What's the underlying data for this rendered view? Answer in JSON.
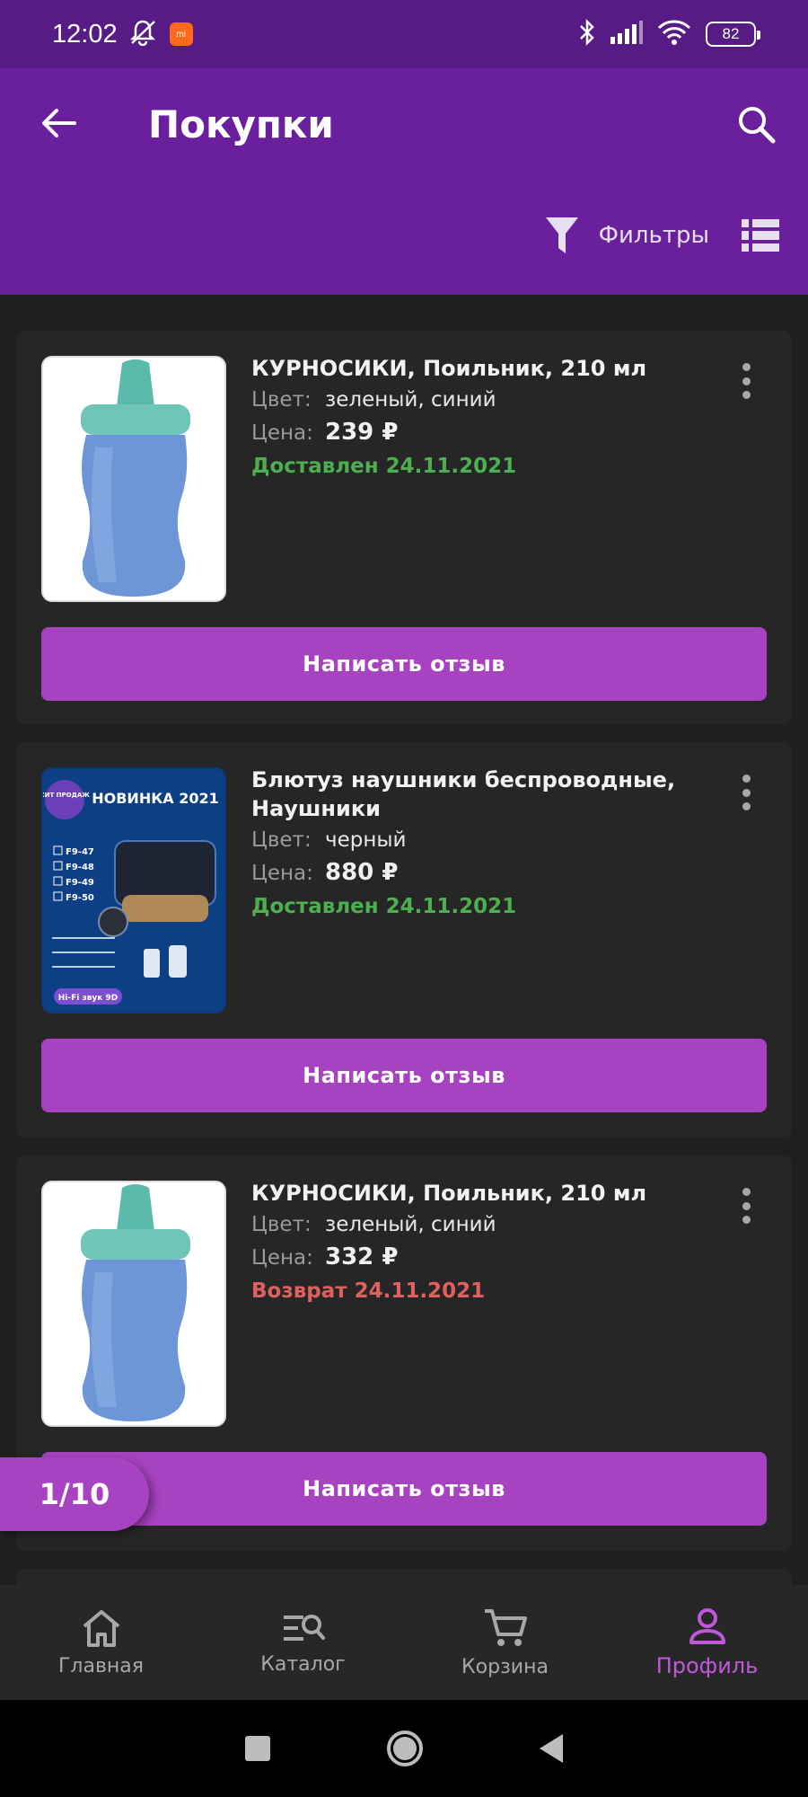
{
  "status_bar": {
    "time": "12:02",
    "battery": "82"
  },
  "header": {
    "title": "Покупки",
    "filters_label": "Фильтры"
  },
  "colors": {
    "accent": "#a742c0",
    "appbar": "#6a1f9c",
    "delivered": "#4caf50",
    "returned": "#e06060"
  },
  "orders": [
    {
      "name": "КУРНОСИКИ, Поильник, 210 мл",
      "color_key": "Цвет:",
      "color": "зеленый, синий",
      "price_key": "Цена:",
      "price": "239 ₽",
      "status": "Доставлен 24.11.2021",
      "review": "Написать отзыв",
      "image": "sippy-cup"
    },
    {
      "name": "Блютуз наушники беспроводные, Наушники",
      "color_key": "Цвет:",
      "color": "черный",
      "price_key": "Цена:",
      "price": "880 ₽",
      "status": "Доставлен 24.11.2021",
      "review": "Написать отзыв",
      "image": "earbuds-promo",
      "image_text": {
        "badge": "ХИТ ПРОДАЖ",
        "headline": "НОВИНКА 2021",
        "models": [
          "F9-47",
          "F9-48",
          "F9-49",
          "F9-50"
        ],
        "footer": "Hi-Fi звук 9D"
      }
    },
    {
      "name": "КУРНОСИКИ, Поильник, 210 мл",
      "color_key": "Цвет:",
      "color": "зеленый, синий",
      "price_key": "Цена:",
      "price": "332 ₽",
      "status": "Возврат 24.11.2021",
      "review": "Написать отзыв",
      "image": "sippy-cup"
    }
  ],
  "pager": "1/10",
  "bottom_nav": [
    {
      "label": "Главная",
      "icon": "home-icon"
    },
    {
      "label": "Каталог",
      "icon": "catalog-search-icon"
    },
    {
      "label": "Корзина",
      "icon": "cart-icon"
    },
    {
      "label": "Профиль",
      "icon": "profile-icon",
      "active": true
    }
  ]
}
